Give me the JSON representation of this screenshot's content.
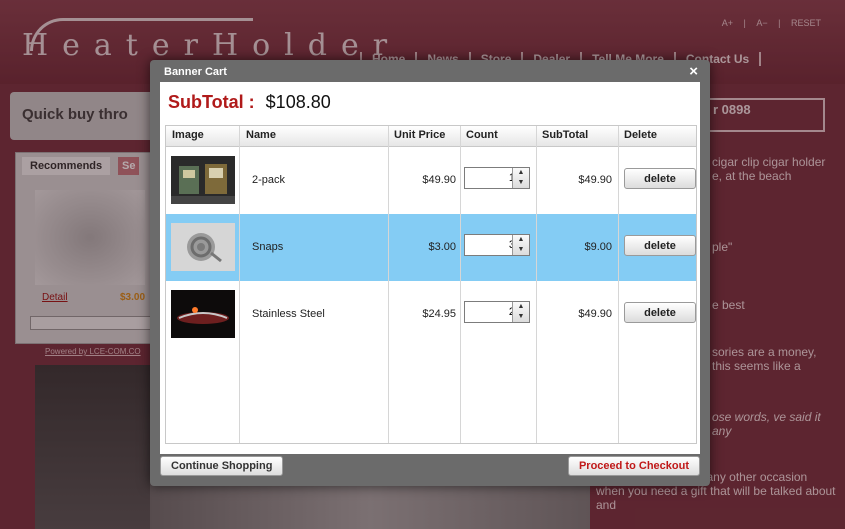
{
  "site": {
    "logo_text": "HeaterHolder",
    "top_links": [
      "A+",
      "|",
      "A−",
      "|",
      "RESET"
    ],
    "nav": [
      "Home",
      "News",
      "Store",
      "Dealer",
      "Tell Me More",
      "Contact Us"
    ],
    "quick_buy": "Quick buy thro",
    "right_box": "r 0898",
    "side_tabs": [
      "Recommends",
      "Se"
    ],
    "side_detail": "Detail",
    "side_price": "$3.00",
    "powered_by": "Powered by LCE-COM.CO",
    "right_texts": [
      "cigar clip cigar holder e, at the beach",
      "ple\"",
      "e best",
      "sories are a money, this seems like a",
      "ose words, ve said it any"
    ],
    "bottom_right_text": "Day, Groomsmen or any other occasion when you need a gift that will be talked about and"
  },
  "modal": {
    "title": "Banner Cart",
    "close": "×",
    "subtotal_label": "SubTotal :",
    "subtotal_value": "$108.80",
    "columns": [
      "Image",
      "Name",
      "Unit Price",
      "Count",
      "SubTotal",
      "Delete"
    ],
    "rows": [
      {
        "name": "2-pack",
        "unit_price": "$49.90",
        "count": "1",
        "subtotal": "$49.90",
        "delete": "delete",
        "selected": false
      },
      {
        "name": "Snaps",
        "unit_price": "$3.00",
        "count": "3",
        "subtotal": "$9.00",
        "delete": "delete",
        "selected": true
      },
      {
        "name": "Stainless Steel",
        "unit_price": "$24.95",
        "count": "2",
        "subtotal": "$49.90",
        "delete": "delete",
        "selected": false
      }
    ],
    "continue_label": "Continue Shopping",
    "checkout_label": "Proceed to Checkout"
  },
  "colors": {
    "accent": "#b01a1a",
    "selection": "#84ccf4",
    "background": "#7a3542"
  }
}
